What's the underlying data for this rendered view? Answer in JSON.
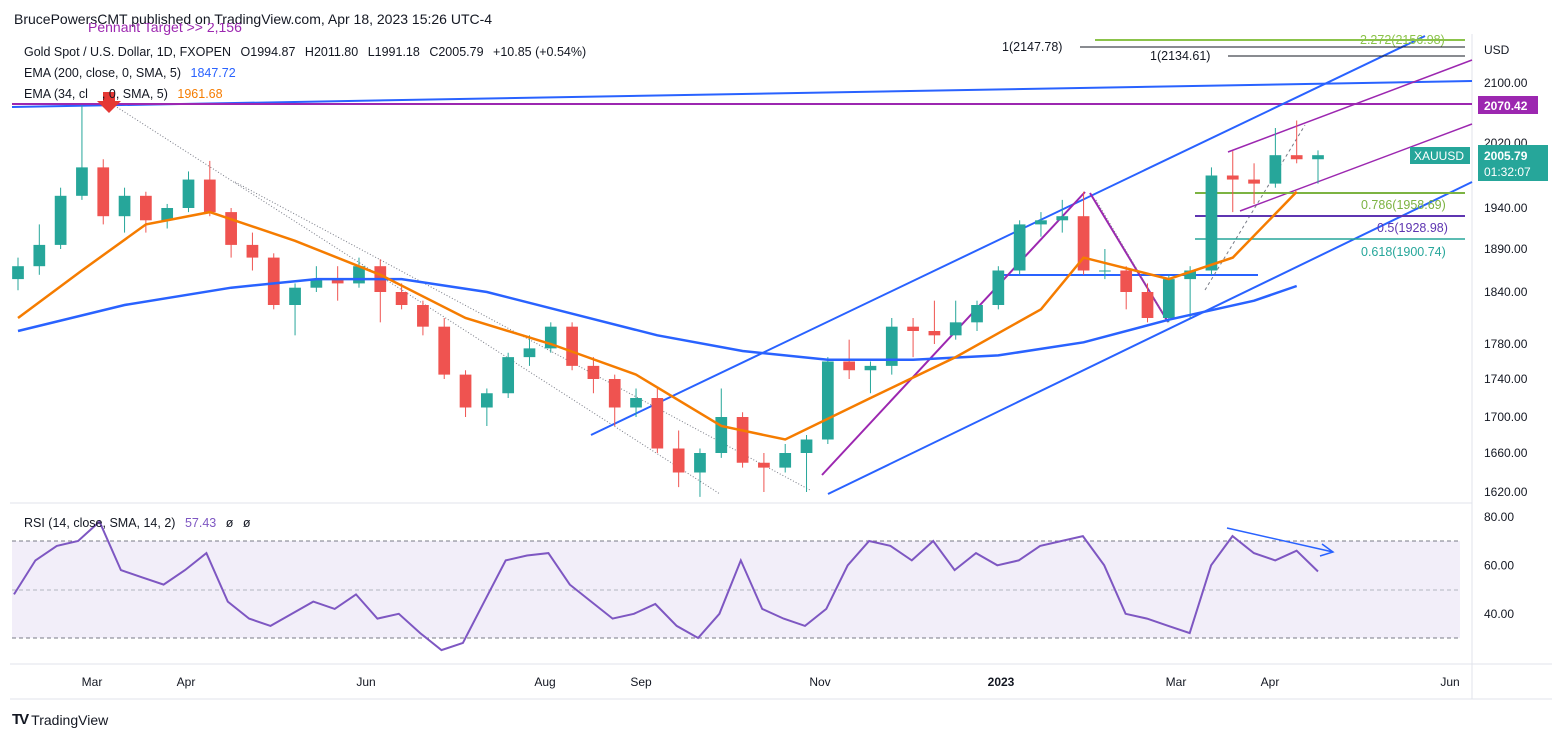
{
  "publisher": "BrucePowersCMT published on TradingView.com, Apr 18, 2023 15:26 UTC-4",
  "main_legend": {
    "symbol": "Gold Spot / U.S. Dollar, 1D, FXOPEN",
    "open": "O1994.87",
    "high": "H2011.80",
    "low": "L1991.18",
    "close": "C2005.79",
    "change": "+10.85 (+0.54%)",
    "ema200_label": "EMA (200, close, 0, SMA, 5)",
    "ema200_value": "1847.72",
    "ema34_label_a": "EMA (34, cl",
    "ema34_label_b": ", 0, SMA, 5)",
    "ema34_value": "1961.68"
  },
  "annotation_pennant": "Pennant Target >> 2,156",
  "price_axis": {
    "currency": "USD",
    "ticks": [
      "2100.00",
      "2020.00",
      "1940.00",
      "1890.00",
      "1840.00",
      "1780.00",
      "1740.00",
      "1700.00",
      "1660.00",
      "1620.00"
    ]
  },
  "rsi_axis": {
    "ticks": [
      "80.00",
      "60.00",
      "40.00"
    ]
  },
  "rsi_legend": {
    "label": "RSI (14, close, SMA, 14, 2)",
    "value": "57.43",
    "extra1": "ø",
    "extra2": "ø"
  },
  "time_axis": {
    "ticks": [
      "Mar",
      "Apr",
      "Jun",
      "Aug",
      "Sep",
      "Nov",
      "2023",
      "Mar",
      "Apr",
      "Jun"
    ]
  },
  "levels": {
    "ext_2272": "2.272(2156.98)",
    "ext_1_a": "1(2147.78)",
    "ext_1_b": "1(2134.61)",
    "fib_786": "0.786(1958.69)",
    "fib_5": "0.5(1928.98)",
    "fib_618": "0.618(1900.74)",
    "resistance_tag": "2070.42"
  },
  "price_tag": {
    "symbol": "XAUUSD",
    "price": "2005.79",
    "countdown": "01:32:07"
  },
  "footer": {
    "brand_icon": "TV",
    "brand": "TradingView"
  },
  "colors": {
    "up": "#26a69a",
    "down": "#ef5350",
    "ema200": "#2962ff",
    "ema34": "#f57c00",
    "channel": "#2962ff",
    "pennant": "#9c27b0",
    "fib_green": "#7cb342",
    "rsi": "#7e57c2"
  },
  "chart_data": {
    "type": "candlestick",
    "series": [
      {
        "name": "Gold Spot / U.S. Dollar",
        "points": [
          [
            "2022-02-14",
            1855,
            1880,
            1842,
            1870
          ],
          [
            "2022-02-21",
            1870,
            1920,
            1860,
            1895
          ],
          [
            "2022-02-28",
            1895,
            1965,
            1890,
            1955
          ],
          [
            "2022-03-07",
            1955,
            2070,
            1950,
            1990
          ],
          [
            "2022-03-14",
            1990,
            2000,
            1920,
            1930
          ],
          [
            "2022-03-21",
            1930,
            1965,
            1910,
            1955
          ],
          [
            "2022-03-28",
            1955,
            1960,
            1910,
            1925
          ],
          [
            "2022-04-04",
            1925,
            1945,
            1915,
            1940
          ],
          [
            "2022-04-11",
            1940,
            1985,
            1935,
            1975
          ],
          [
            "2022-04-18",
            1975,
            1998,
            1930,
            1935
          ],
          [
            "2022-04-25",
            1935,
            1940,
            1880,
            1895
          ],
          [
            "2022-05-02",
            1895,
            1910,
            1865,
            1880
          ],
          [
            "2022-05-09",
            1880,
            1885,
            1820,
            1825
          ],
          [
            "2022-05-16",
            1825,
            1850,
            1790,
            1845
          ],
          [
            "2022-05-23",
            1845,
            1870,
            1840,
            1855
          ],
          [
            "2022-05-30",
            1855,
            1870,
            1830,
            1850
          ],
          [
            "2022-06-06",
            1850,
            1880,
            1845,
            1870
          ],
          [
            "2022-06-13",
            1870,
            1878,
            1805,
            1840
          ],
          [
            "2022-06-20",
            1840,
            1850,
            1820,
            1825
          ],
          [
            "2022-06-27",
            1825,
            1830,
            1790,
            1800
          ],
          [
            "2022-07-04",
            1800,
            1810,
            1740,
            1745
          ],
          [
            "2022-07-11",
            1745,
            1750,
            1700,
            1710
          ],
          [
            "2022-07-18",
            1710,
            1730,
            1690,
            1725
          ],
          [
            "2022-07-25",
            1725,
            1770,
            1720,
            1765
          ],
          [
            "2022-08-01",
            1765,
            1790,
            1755,
            1775
          ],
          [
            "2022-08-08",
            1775,
            1805,
            1770,
            1800
          ],
          [
            "2022-08-15",
            1800,
            1805,
            1750,
            1755
          ],
          [
            "2022-08-22",
            1755,
            1765,
            1725,
            1740
          ],
          [
            "2022-08-29",
            1740,
            1745,
            1690,
            1710
          ],
          [
            "2022-09-05",
            1710,
            1730,
            1700,
            1720
          ],
          [
            "2022-09-12",
            1720,
            1730,
            1660,
            1665
          ],
          [
            "2022-09-19",
            1665,
            1685,
            1625,
            1640
          ],
          [
            "2022-09-26",
            1640,
            1665,
            1615,
            1660
          ],
          [
            "2022-10-03",
            1660,
            1730,
            1655,
            1700
          ],
          [
            "2022-10-10",
            1700,
            1705,
            1645,
            1650
          ],
          [
            "2022-10-17",
            1650,
            1660,
            1620,
            1645
          ],
          [
            "2022-10-24",
            1645,
            1670,
            1640,
            1660
          ],
          [
            "2022-10-31",
            1660,
            1680,
            1620,
            1675
          ],
          [
            "2022-11-07",
            1675,
            1765,
            1670,
            1760
          ],
          [
            "2022-11-14",
            1760,
            1785,
            1740,
            1750
          ],
          [
            "2022-11-21",
            1750,
            1760,
            1725,
            1755
          ],
          [
            "2022-11-28",
            1755,
            1810,
            1745,
            1800
          ],
          [
            "2022-12-05",
            1800,
            1810,
            1765,
            1795
          ],
          [
            "2022-12-12",
            1795,
            1830,
            1780,
            1790
          ],
          [
            "2022-12-19",
            1790,
            1830,
            1785,
            1805
          ],
          [
            "2022-12-26",
            1805,
            1830,
            1795,
            1825
          ],
          [
            "2023-01-02",
            1825,
            1870,
            1820,
            1865
          ],
          [
            "2023-01-09",
            1865,
            1925,
            1860,
            1920
          ],
          [
            "2023-01-16",
            1920,
            1935,
            1905,
            1925
          ],
          [
            "2023-01-23",
            1925,
            1950,
            1910,
            1930
          ],
          [
            "2023-01-30",
            1930,
            1960,
            1860,
            1865
          ],
          [
            "2023-02-06",
            1865,
            1890,
            1855,
            1865
          ],
          [
            "2023-02-13",
            1865,
            1870,
            1820,
            1840
          ],
          [
            "2023-02-20",
            1840,
            1850,
            1805,
            1810
          ],
          [
            "2023-02-27",
            1810,
            1860,
            1805,
            1855
          ],
          [
            "2023-03-06",
            1855,
            1870,
            1810,
            1865
          ],
          [
            "2023-03-13",
            1865,
            1990,
            1860,
            1980
          ],
          [
            "2023-03-20",
            1980,
            2010,
            1935,
            1975
          ],
          [
            "2023-03-27",
            1975,
            1995,
            1945,
            1970
          ],
          [
            "2023-04-03",
            1970,
            2040,
            1965,
            2005
          ],
          [
            "2023-04-10",
            2005,
            2050,
            1995,
            2000
          ],
          [
            "2023-04-17",
            2000,
            2011,
            1970,
            2005
          ]
        ]
      }
    ],
    "xlabel": "",
    "ylabel": "USD",
    "ylim": [
      1610,
      2160
    ],
    "overlays": {
      "ema200": [
        [
          0,
          1795
        ],
        [
          5,
          1825
        ],
        [
          10,
          1845
        ],
        [
          14,
          1855
        ],
        [
          18,
          1855
        ],
        [
          22,
          1840
        ],
        [
          26,
          1815
        ],
        [
          30,
          1790
        ],
        [
          34,
          1772
        ],
        [
          38,
          1762
        ],
        [
          42,
          1762
        ],
        [
          46,
          1767
        ],
        [
          50,
          1782
        ],
        [
          54,
          1808
        ],
        [
          58,
          1830
        ],
        [
          60,
          1847
        ]
      ],
      "ema34": [
        [
          0,
          1810
        ],
        [
          3,
          1865
        ],
        [
          6,
          1920
        ],
        [
          9,
          1935
        ],
        [
          13,
          1900
        ],
        [
          17,
          1860
        ],
        [
          21,
          1810
        ],
        [
          25,
          1780
        ],
        [
          29,
          1745
        ],
        [
          33,
          1690
        ],
        [
          36,
          1675
        ],
        [
          40,
          1720
        ],
        [
          44,
          1765
        ],
        [
          48,
          1820
        ],
        [
          50,
          1880
        ],
        [
          54,
          1855
        ],
        [
          57,
          1880
        ],
        [
          60,
          1960
        ]
      ]
    },
    "rsi": {
      "ylim": [
        20,
        85
      ],
      "bands": [
        30,
        50,
        70
      ],
      "values": [
        48,
        62,
        68,
        70,
        78,
        58,
        55,
        52,
        58,
        65,
        45,
        38,
        35,
        40,
        45,
        42,
        48,
        38,
        40,
        32,
        25,
        28,
        45,
        62,
        64,
        65,
        52,
        45,
        38,
        40,
        44,
        35,
        30,
        40,
        62,
        42,
        38,
        35,
        42,
        60,
        70,
        68,
        62,
        70,
        58,
        65,
        60,
        62,
        68,
        70,
        72,
        60,
        40,
        38,
        35,
        32,
        60,
        72,
        65,
        62,
        66,
        57.43
      ]
    }
  }
}
